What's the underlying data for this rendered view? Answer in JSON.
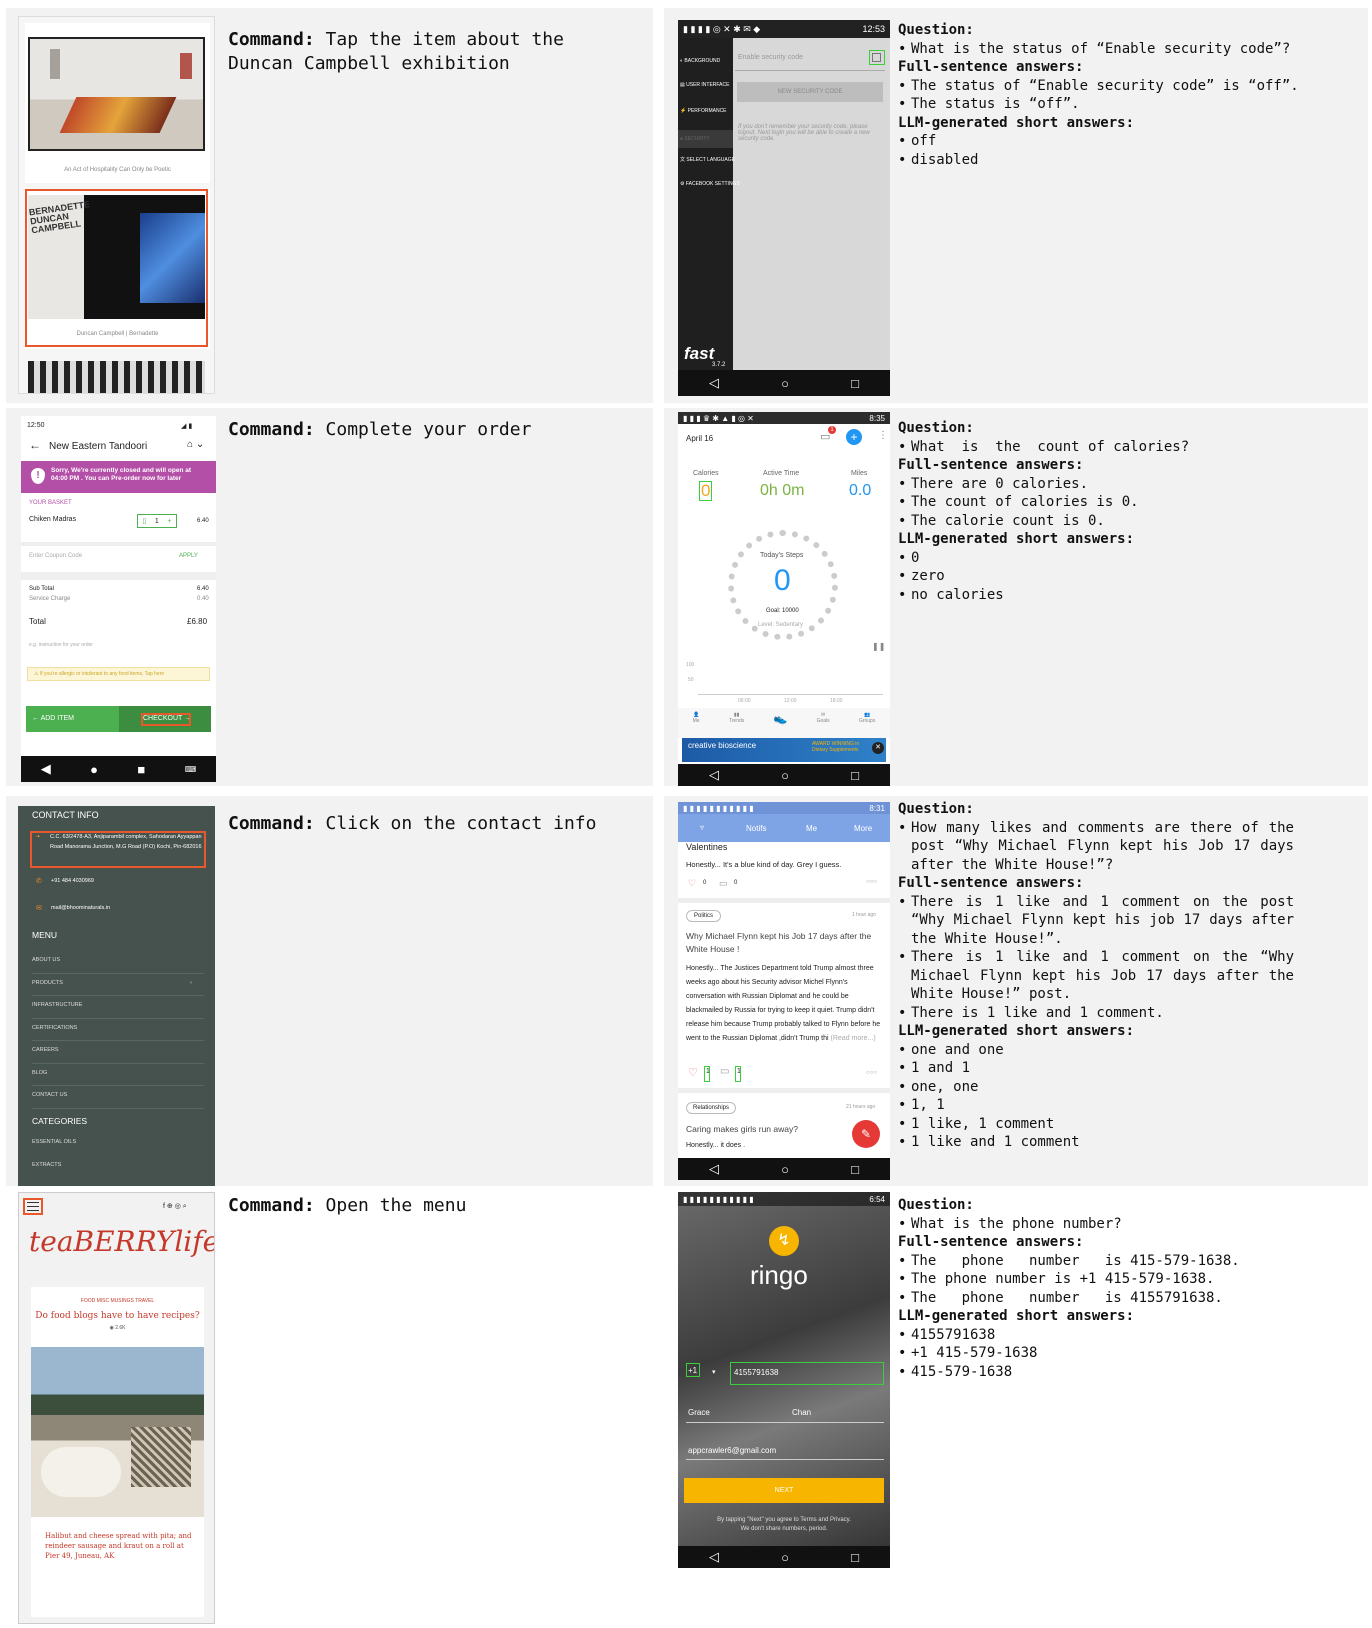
{
  "p1": {
    "command_label": "Command:",
    "command_text": " Tap the item about the",
    "command_text2": "Duncan Campbell exhibition",
    "caption1": "An Act of Hospitality Can Only be Poetic",
    "card_text": "BERNADETTE DUNCAN CAMPBELL",
    "caption2": "Duncan Campbell | Bernadette"
  },
  "p2": {
    "time": "12:53",
    "menu": [
      "BACKGROUND",
      "USER INTERFACE",
      "PERFORMANCE",
      "SECURITY",
      "SELECT LANGUAGE",
      "FACEBOOK SETTINGS"
    ],
    "field_placeholder": "Enable security code",
    "button": "NEW SECURITY CODE",
    "hint": "If you don't remember your security code, please logout. Next login you will be able to create a new security code.",
    "logo": "fast",
    "version": "3.7.2",
    "q_label": "Question:",
    "question": "What is the status of “Enable security code”?",
    "full_label": "Full-sentence answers:",
    "full": [
      "The status of “Enable security code” is “off”.",
      "The status is “off”."
    ],
    "short_label": "LLM-generated short answers:",
    "short": [
      "off",
      "disabled"
    ]
  },
  "p3": {
    "time": "12:50",
    "title": "New Eastern Tandoori",
    "banner": "Sorry, We're currently closed and will open at 04:00 PM . You can Pre-order now for later",
    "basket": "YOUR BASKET",
    "item": "Chiken Madras",
    "qty": "1",
    "price": "6.40",
    "coupon_ph": "Enter Coupon Code",
    "apply": "APPLY",
    "subtotal_l": "Sub Total",
    "subtotal_v": "6.40",
    "service_l": "Service Charge",
    "service_v": "0.40",
    "total_l": "Total",
    "total_v": "£6.80",
    "instr": "e.g. instruction for your order",
    "allergy": "If you're allergic or intolerant to any food items, Tap here",
    "add": "ADD ITEM",
    "checkout": "CHECKOUT",
    "command_label": "Command:",
    "command_text": " Complete your order"
  },
  "p4": {
    "date": "April 16",
    "badge": "1",
    "cal_l": "Calories",
    "cal_v": "0",
    "time_l": "Active Time",
    "time_v": "0h 0m",
    "miles_l": "Miles",
    "miles_v": "0.0",
    "steps_l": "Today's Steps",
    "steps_v": "0",
    "goal": "Goal: 10000",
    "level": "Level: Sedentary",
    "y1": "100",
    "y2": "50",
    "x1": "06:00",
    "x2": "12:00",
    "x3": "18:00",
    "tabs": [
      "Me",
      "Trends",
      "",
      "Goals",
      "Groups"
    ],
    "ad": "creative bioscience",
    "ad2": "AWARD WINNING in Dietary Supplements",
    "clock": "8:35",
    "q_label": "Question:",
    "question": "What  is  the  count of calories?",
    "full_label": "Full-sentence answers:",
    "full": [
      "There are 0 calories.",
      "The count of calories is 0.",
      "The calorie count is 0."
    ],
    "short_label": "LLM-generated short answers:",
    "short": [
      "0",
      "zero",
      "no calories"
    ]
  },
  "p5": {
    "contact": "CONTACT INFO",
    "address": "C.C. 63/2478-A3, Anjiparambil complex, Sahodaran Ayyappan Road Manorama Junction, M.G Road (P.O) Kochi, Pin-682016",
    "phone": "+91 484 4030969",
    "email": "mail@bhoominaturals.in",
    "menu": "MENU",
    "items": [
      "ABOUT US",
      "PRODUCTS",
      "INFRASTRUCTURE",
      "CERTIFICATIONS",
      "CAREERS",
      "BLOG",
      "CONTACT US"
    ],
    "categories": "CATEGORIES",
    "cats": [
      "ESSENTIAL OILS",
      "EXTRACTS"
    ],
    "command_label": "Command:",
    "command_text": " Click on the contact info"
  },
  "p6": {
    "clock": "8:31",
    "tabs": [
      "Notifs",
      "Me",
      "More"
    ],
    "prev_title": "Valentines",
    "prev_body": "Honestly... It's a blue kind of day. Grey I guess.",
    "prev_likes": "0",
    "prev_comments": "0",
    "tag": "Politics",
    "ago": "1 hour ago",
    "title": "Why Michael Flynn kept his Job 17 days after the White House !",
    "body": "Honestly... The Justices Department told Trump almost three weeks ago about his Security advisor Michel Flynn's conversation with Russian Diplomat and he could be blackmailed by Russia for trying to keep it quiet. Trump didn't release him because Trump probably talked to Flynn  before he went to the Russian Diplomat ,didn't Trump thi",
    "more": "(Read more...)",
    "likes": "1",
    "comments": "1",
    "tag2": "Relationships",
    "ago2": "21 hours ago",
    "title2": "Caring makes girls run away?",
    "body2": "Honestly... it does .",
    "q_label": "Question:",
    "question": "How  many  likes and comments are there of the post “Why Michael Flynn kept his Job 17 days after the White House!”?",
    "full_label": "Full-sentence answers:",
    "full": [
      "There is 1 like and 1 comment  on  the  post “Why Michael Flynn kept his job  17  days after  the White House!”.",
      "There  is  1  like  and  1 comment  on the  “Why Michael Flynn  kept his Job  17 days  after  the White House!” post.",
      "There is 1 like and 1 comment."
    ],
    "short_label": "LLM-generated short answers:",
    "short": [
      "one and one",
      "1 and 1",
      "one, one",
      "1, 1",
      "1 like, 1 comment",
      "1 like and 1 comment"
    ]
  },
  "p7": {
    "logo": "teaBERRYlife",
    "cats": "FOOD MISC MUSINGS TRAVEL",
    "post": "Do food blogs have to have recipes?",
    "views": "2.6K",
    "caption": "Halibut and cheese spread with pita; and reindeer sausage and kraut on a roll at Pier 49, Juneau, AK",
    "command_label": "Command:",
    "command_text": " Open the menu"
  },
  "p8": {
    "clock": "6:54",
    "brand": "ringo",
    "code": "+1",
    "phone": "4155791638",
    "first": "Grace",
    "last": "Chan",
    "email": "appcrawler6@gmail.com",
    "next": "NEXT",
    "terms": "By tapping \"Next\" you agree to Terms and Privacy.",
    "terms2": "We don't share numbers, period.",
    "q_label": "Question:",
    "question": "What is the phone number?",
    "full_label": "Full-sentence answers:",
    "full": [
      "The   phone   number   is 415-579-1638.",
      "The phone number is +1 415-579-1638.",
      "The   phone   number   is 4155791638."
    ],
    "short_label": "LLM-generated short answers:",
    "short": [
      "4155791638",
      "+1 415-579-1638",
      "415-579-1638"
    ]
  },
  "colors": {
    "panel": "#f2f2f2",
    "orange_box": "#e8582a",
    "green_box": "#3ccf3c",
    "purple": "#b44fa8",
    "green_btn": "#4caf50",
    "blue": "#2196f3",
    "teal": "#46524e",
    "yellow": "#f7b500",
    "slack_blue": "#7fa4e6"
  }
}
